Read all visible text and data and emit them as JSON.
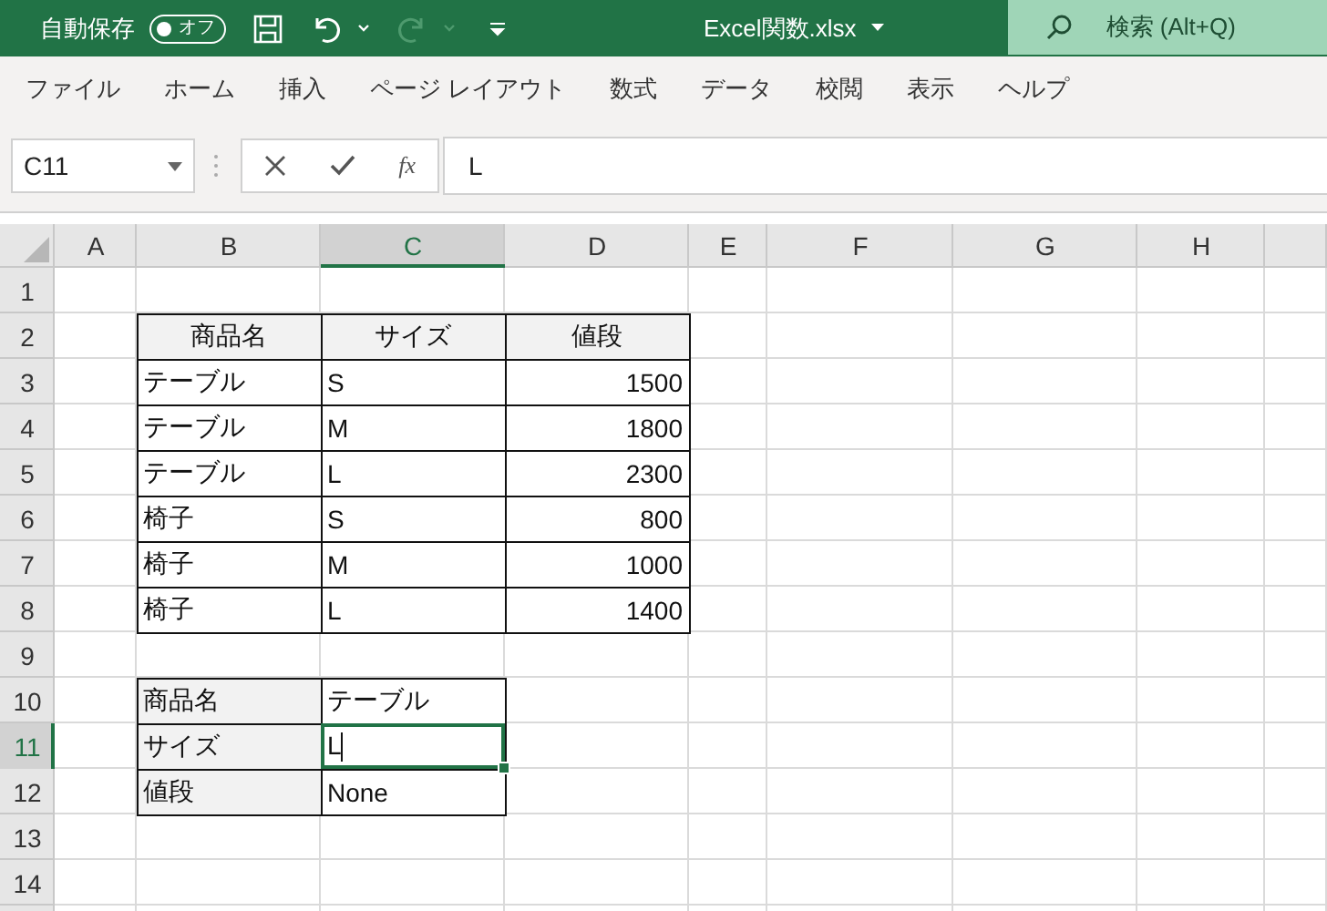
{
  "title_bar": {
    "autosave_label": "自動保存",
    "autosave_toggle": {
      "label": "オフ",
      "on": false
    },
    "title": "Excel関数.xlsx",
    "search": {
      "placeholder": "検索 (Alt+Q)"
    }
  },
  "menu_tabs": [
    "ファイル",
    "ホーム",
    "挿入",
    "ページ レイアウト",
    "数式",
    "データ",
    "校閲",
    "表示",
    "ヘルプ"
  ],
  "formula_bar": {
    "name_box": "C11",
    "fx_label": "fx",
    "value": "L"
  },
  "sheet": {
    "column_headers": [
      {
        "label": "A",
        "selected": false
      },
      {
        "label": "B",
        "selected": false
      },
      {
        "label": "C",
        "selected": true
      },
      {
        "label": "D",
        "selected": false
      },
      {
        "label": "E",
        "selected": false
      },
      {
        "label": "F",
        "selected": false
      },
      {
        "label": "G",
        "selected": false
      },
      {
        "label": "H",
        "selected": false
      }
    ],
    "rows": [
      {
        "number": "1",
        "selected": false,
        "cells": []
      },
      {
        "number": "2",
        "selected": false,
        "cells": [
          {
            "kind": "blank"
          },
          {
            "kind": "header",
            "text": "商品名"
          },
          {
            "kind": "header",
            "text": "サイズ"
          },
          {
            "kind": "header",
            "text": "値段"
          }
        ]
      },
      {
        "number": "3",
        "selected": false,
        "cells": [
          {
            "kind": "blank"
          },
          {
            "kind": "text",
            "text": "テーブル"
          },
          {
            "kind": "text",
            "text": "S"
          },
          {
            "kind": "number",
            "text": "1500"
          }
        ]
      },
      {
        "number": "4",
        "selected": false,
        "cells": [
          {
            "kind": "blank"
          },
          {
            "kind": "text",
            "text": "テーブル"
          },
          {
            "kind": "text",
            "text": "M"
          },
          {
            "kind": "number",
            "text": "1800"
          }
        ]
      },
      {
        "number": "5",
        "selected": false,
        "cells": [
          {
            "kind": "blank"
          },
          {
            "kind": "text",
            "text": "テーブル"
          },
          {
            "kind": "text",
            "text": "L"
          },
          {
            "kind": "number",
            "text": "2300"
          }
        ]
      },
      {
        "number": "6",
        "selected": false,
        "cells": [
          {
            "kind": "blank"
          },
          {
            "kind": "text",
            "text": "椅子"
          },
          {
            "kind": "text",
            "text": "S"
          },
          {
            "kind": "number",
            "text": "800"
          }
        ]
      },
      {
        "number": "7",
        "selected": false,
        "cells": [
          {
            "kind": "blank"
          },
          {
            "kind": "text",
            "text": "椅子"
          },
          {
            "kind": "text",
            "text": "M"
          },
          {
            "kind": "number",
            "text": "1000"
          }
        ]
      },
      {
        "number": "8",
        "selected": false,
        "cells": [
          {
            "kind": "blank"
          },
          {
            "kind": "text",
            "text": "椅子"
          },
          {
            "kind": "text",
            "text": "L"
          },
          {
            "kind": "number",
            "text": "1400"
          }
        ]
      },
      {
        "number": "9",
        "selected": false,
        "cells": []
      },
      {
        "number": "10",
        "selected": false,
        "cells": [
          {
            "kind": "blank"
          },
          {
            "kind": "label",
            "text": "商品名"
          },
          {
            "kind": "text",
            "text": "テーブル"
          }
        ]
      },
      {
        "number": "11",
        "selected": true,
        "cells": [
          {
            "kind": "blank"
          },
          {
            "kind": "label",
            "text": "サイズ"
          },
          {
            "kind": "text",
            "text": "L"
          }
        ]
      },
      {
        "number": "12",
        "selected": false,
        "cells": [
          {
            "kind": "blank"
          },
          {
            "kind": "label",
            "text": "値段"
          },
          {
            "kind": "text",
            "text": "None"
          }
        ]
      },
      {
        "number": "13",
        "selected": false,
        "cells": []
      },
      {
        "number": "14",
        "selected": false,
        "cells": []
      }
    ]
  }
}
